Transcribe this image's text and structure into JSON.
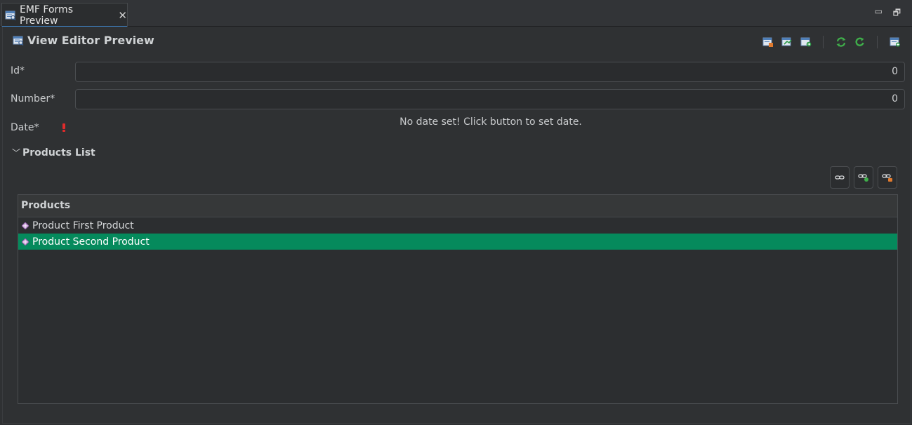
{
  "tab": {
    "title": "EMF Forms Preview",
    "close": "✕",
    "minimize": "▭",
    "restore": "🗗"
  },
  "header": {
    "title": "View Editor Preview"
  },
  "toolbar": {
    "buttons": [
      {
        "name": "view-model-icon"
      },
      {
        "name": "export-icon"
      },
      {
        "name": "import-icon"
      },
      {
        "name": "refresh-icon"
      },
      {
        "name": "auto-refresh-icon"
      },
      {
        "name": "new-view-icon"
      }
    ]
  },
  "form": {
    "id": {
      "label": "Id*",
      "value": "0"
    },
    "number": {
      "label": "Number*",
      "value": "0"
    },
    "date": {
      "label": "Date*",
      "message": "No date set! Click button to set date."
    }
  },
  "products_section": {
    "title": "Products List",
    "chevron": "﹀",
    "table": {
      "header": "Products",
      "rows": [
        {
          "label": "Product First Product",
          "selected": false
        },
        {
          "label": "Product Second Product",
          "selected": true
        }
      ]
    }
  },
  "colors": {
    "accent": "#3f7fbf",
    "selection": "#058a5c",
    "warning": "#e02b2b"
  }
}
